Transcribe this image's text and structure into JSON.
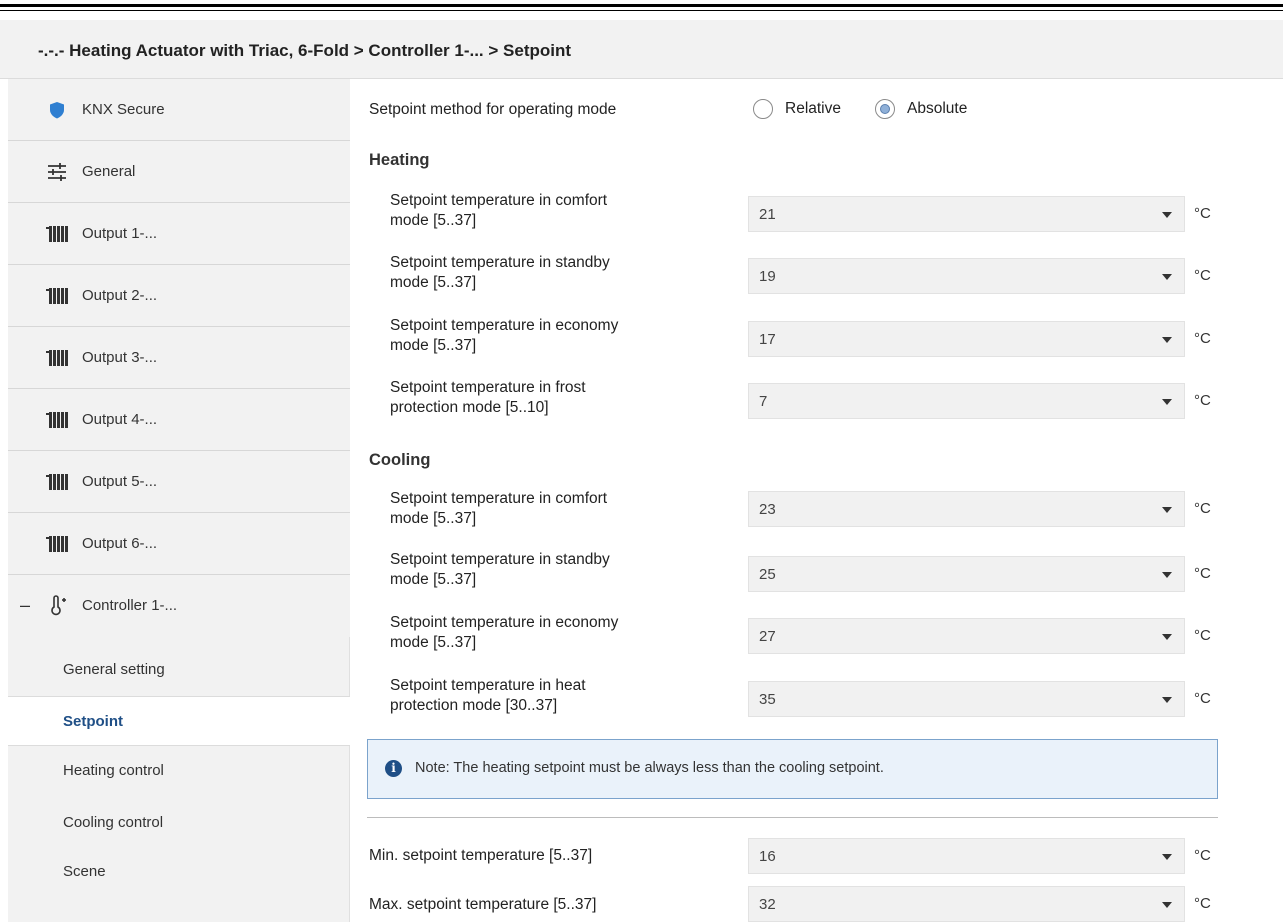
{
  "window": {
    "title": "-.-.- Heating Actuator with Triac, 6-Fold > Controller 1-... > Setpoint"
  },
  "sidebar": {
    "items": [
      {
        "label": "KNX Secure",
        "icon": "shield-icon"
      },
      {
        "label": "General",
        "icon": "sliders-icon"
      },
      {
        "label": "Output 1-...",
        "icon": "radiator-icon"
      },
      {
        "label": "Output 2-...",
        "icon": "radiator-icon"
      },
      {
        "label": "Output 3-...",
        "icon": "radiator-icon"
      },
      {
        "label": "Output 4-...",
        "icon": "radiator-icon"
      },
      {
        "label": "Output 5-...",
        "icon": "radiator-icon"
      },
      {
        "label": "Output 6-...",
        "icon": "radiator-icon"
      },
      {
        "label": "Controller 1-...",
        "icon": "thermometer-icon",
        "collapse": "–"
      }
    ],
    "subitems": [
      {
        "label": "General setting"
      },
      {
        "label": "Setpoint",
        "active": true
      },
      {
        "label": "Heating control"
      },
      {
        "label": "Cooling control"
      },
      {
        "label": "Scene"
      }
    ]
  },
  "main": {
    "method": {
      "label": "Setpoint method for operating mode",
      "options": [
        "Relative",
        "Absolute"
      ],
      "selected": "Absolute"
    },
    "heating": {
      "title": "Heating",
      "rows": [
        {
          "label1": "Setpoint temperature in comfort",
          "label2": "mode [5..37]",
          "value": "21",
          "unit": "°C"
        },
        {
          "label1": "Setpoint temperature in standby",
          "label2": "mode [5..37]",
          "value": "19",
          "unit": "°C"
        },
        {
          "label1": "Setpoint temperature in economy",
          "label2": "mode [5..37]",
          "value": "17",
          "unit": "°C"
        },
        {
          "label1": "Setpoint temperature in frost",
          "label2": "protection mode [5..10]",
          "value": "7",
          "unit": "°C"
        }
      ]
    },
    "cooling": {
      "title": "Cooling",
      "rows": [
        {
          "label1": "Setpoint temperature in comfort",
          "label2": "mode [5..37]",
          "value": "23",
          "unit": "°C"
        },
        {
          "label1": "Setpoint temperature in standby",
          "label2": "mode [5..37]",
          "value": "25",
          "unit": "°C"
        },
        {
          "label1": "Setpoint temperature in economy",
          "label2": "mode [5..37]",
          "value": "27",
          "unit": "°C"
        },
        {
          "label1": "Setpoint temperature in heat",
          "label2": "protection mode [30..37]",
          "value": "35",
          "unit": "°C"
        }
      ]
    },
    "note": "Note: The heating setpoint must be always less than the cooling setpoint.",
    "limits": [
      {
        "label": "Min. setpoint temperature [5..37]",
        "value": "16",
        "unit": "°C"
      },
      {
        "label": "Max. setpoint temperature [5..37]",
        "value": "32",
        "unit": "°C"
      }
    ]
  }
}
